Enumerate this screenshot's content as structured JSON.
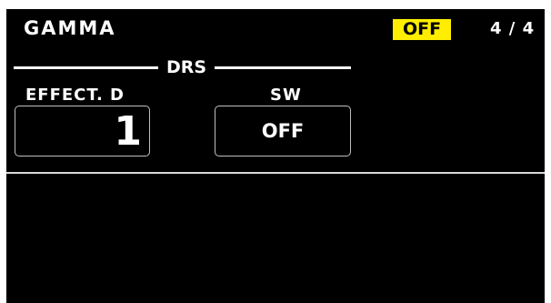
{
  "header": {
    "title": "GAMMA",
    "status_badge": "OFF",
    "status_badge_color": "#ffee00",
    "page_indicator": "4 / 4"
  },
  "drs": {
    "group_title": "DRS",
    "effect_depth": {
      "label": "EFFECT. D",
      "value": "1"
    },
    "switch": {
      "label": "SW",
      "value": "OFF"
    }
  },
  "colors": {
    "background": "#000000",
    "text": "#ffffff",
    "box_border": "#bfbfbf"
  }
}
